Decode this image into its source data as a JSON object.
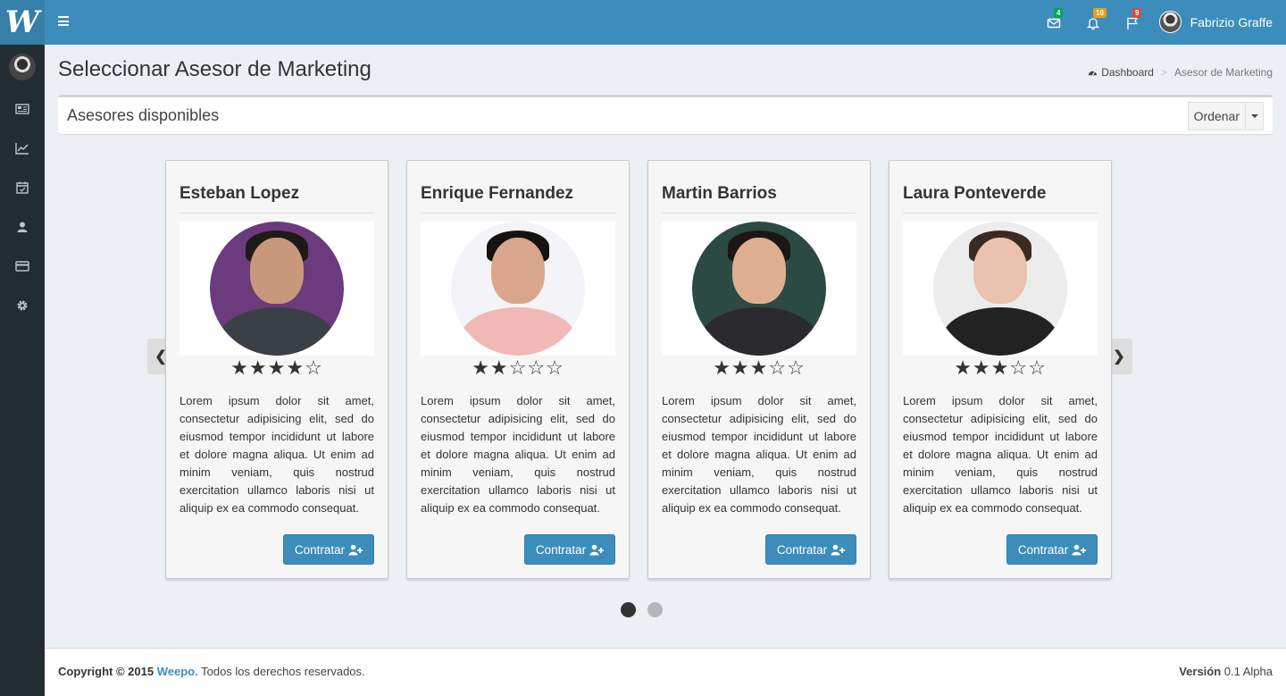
{
  "app": {
    "logo_letter": "W",
    "brand_color": "#3c8dbc"
  },
  "header": {
    "notifications": [
      {
        "icon": "envelope-icon",
        "count": "4",
        "color": "#00a65a"
      },
      {
        "icon": "bell-icon",
        "count": "10",
        "color": "#f39c12"
      },
      {
        "icon": "flag-icon",
        "count": "9",
        "color": "#dd4b39"
      }
    ],
    "user_name": "Fabrizio Graffe"
  },
  "sidebar": {
    "items": [
      {
        "icon": "newspaper-icon"
      },
      {
        "icon": "line-chart-icon"
      },
      {
        "icon": "calendar-check-icon"
      },
      {
        "icon": "user-icon"
      },
      {
        "icon": "credit-card-icon"
      },
      {
        "icon": "gear-icon"
      }
    ]
  },
  "page": {
    "title": "Seleccionar Asesor de Marketing",
    "breadcrumb": {
      "home": "Dashboard",
      "separator": ">",
      "current": "Asesor de Marketing"
    }
  },
  "box": {
    "title": "Asesores disponibles",
    "sort_label": "Ordenar"
  },
  "carousel": {
    "prev": "❮",
    "next": "❯",
    "active_page": 1,
    "pages": 2,
    "advisors": [
      {
        "name": "Esteban Lopez",
        "rating": 4,
        "stars": "★★★★☆",
        "bg": "#6b3b7d",
        "description": "Lorem ipsum dolor sit amet, consectetur adipisicing elit, sed do eiusmod tempor incididunt ut labore et dolore magna aliqua. Ut enim ad minim veniam, quis nostrud exercitation ullamco laboris nisi ut aliquip ex ea commodo consequat.",
        "button": "Contratar"
      },
      {
        "name": "Enrique Fernandez",
        "rating": 2,
        "stars": "★★☆☆☆",
        "bg": "#f4f4f8",
        "description": "Lorem ipsum dolor sit amet, consectetur adipisicing elit, sed do eiusmod tempor incididunt ut labore et dolore magna aliqua. Ut enim ad minim veniam, quis nostrud exercitation ullamco laboris nisi ut aliquip ex ea commodo consequat.",
        "button": "Contratar"
      },
      {
        "name": "Martin Barrios",
        "rating": 3,
        "stars": "★★★☆☆",
        "bg": "#2b4a44",
        "description": "Lorem ipsum dolor sit amet, consectetur adipisicing elit, sed do eiusmod tempor incididunt ut labore et dolore magna aliqua. Ut enim ad minim veniam, quis nostrud exercitation ullamco laboris nisi ut aliquip ex ea commodo consequat.",
        "button": "Contratar"
      },
      {
        "name": "Laura Ponteverde",
        "rating": 3,
        "stars": "★★★☆☆",
        "bg": "#ececec",
        "description": "Lorem ipsum dolor sit amet, consectetur adipisicing elit, sed do eiusmod tempor incididunt ut labore et dolore magna aliqua. Ut enim ad minim veniam, quis nostrud exercitation ullamco laboris nisi ut aliquip ex ea commodo consequat.",
        "button": "Contratar"
      }
    ]
  },
  "footer": {
    "copyright": "Copyright © 2015",
    "brand": "Weepo.",
    "rights": " Todos los derechos reservados.",
    "version_label": "Versión",
    "version_value": " 0.1 Alpha"
  }
}
